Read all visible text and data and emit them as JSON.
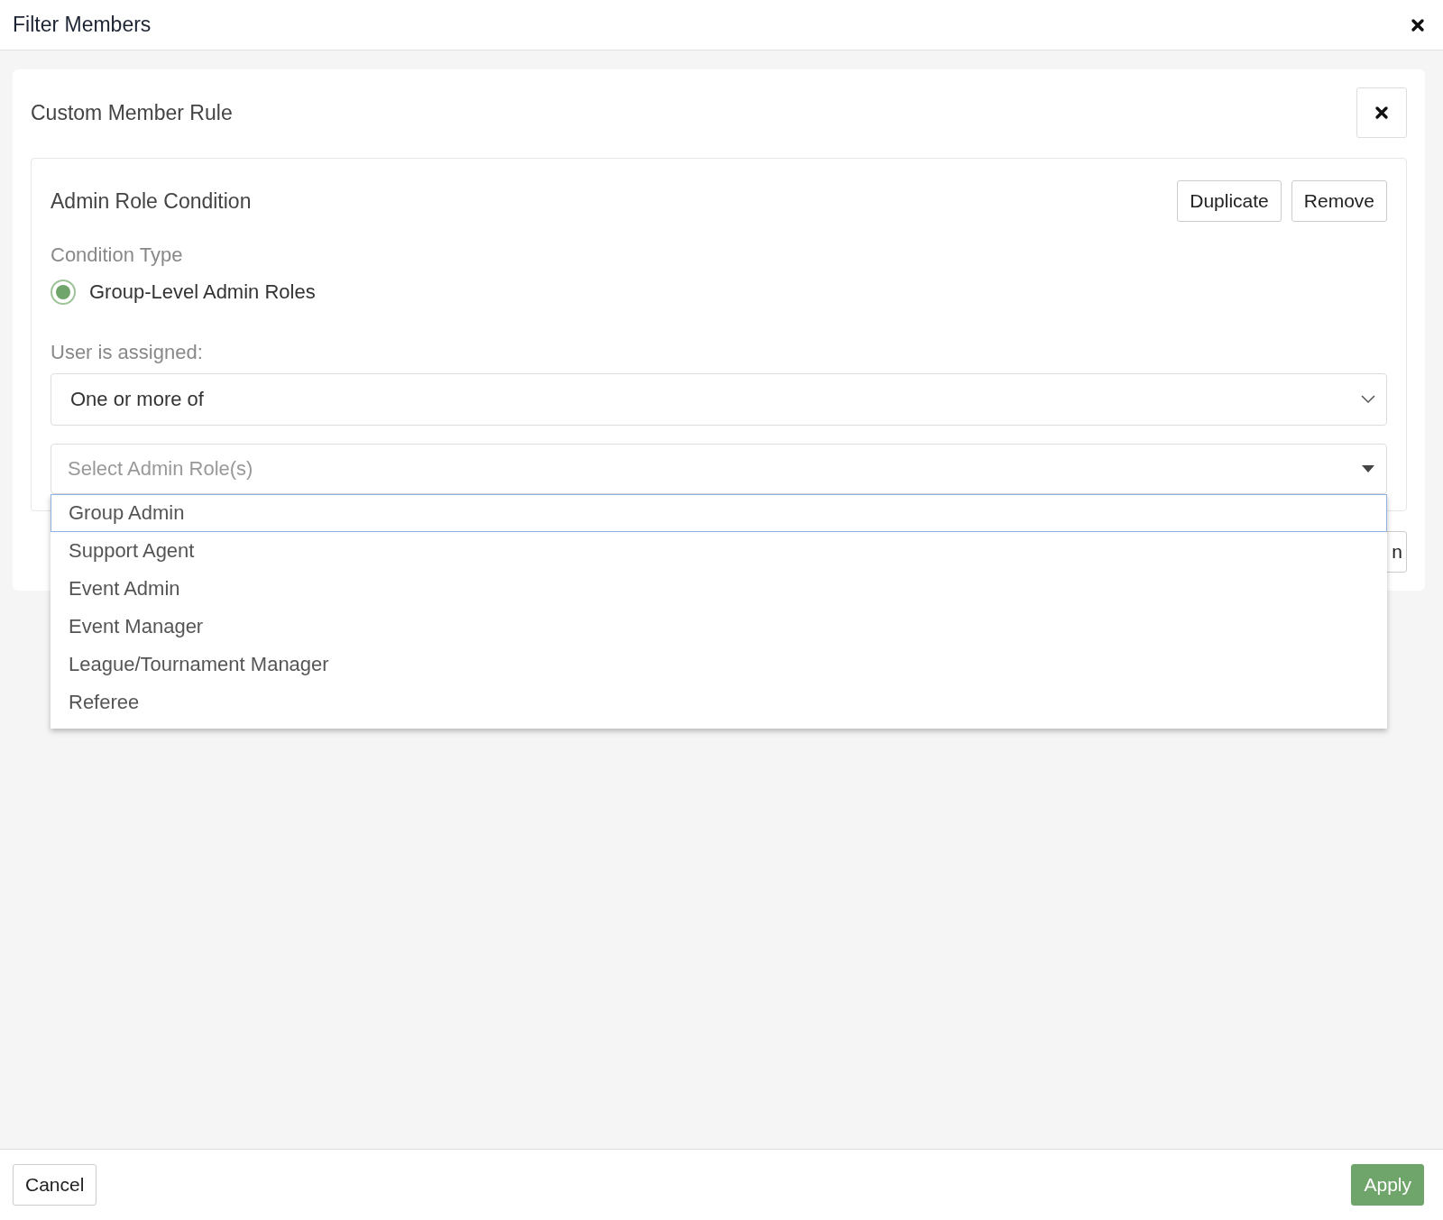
{
  "dialog": {
    "title": "Filter Members"
  },
  "rule": {
    "title": "Custom Member Rule"
  },
  "condition": {
    "title": "Admin Role Condition",
    "buttons": [
      "Duplicate",
      "Remove"
    ],
    "type_label": "Condition Type",
    "types": [
      {
        "label": "Group-Level Admin Roles",
        "selected": true
      }
    ],
    "assigned_label": "User is assigned:",
    "assigned_value": "One or more of",
    "roles_field": {
      "placeholder": "Select Admin Role(s)",
      "expanded": true
    },
    "options": [
      {
        "label": "Group Admin",
        "selected": true
      },
      {
        "label": "Support Agent",
        "selected": false
      },
      {
        "label": "Event Admin",
        "selected": false
      },
      {
        "label": "Event Manager",
        "selected": false
      },
      {
        "label": "League/Tournament Manager",
        "selected": false
      },
      {
        "label": "Referee",
        "selected": false
      }
    ]
  },
  "partial_button": "n",
  "footer": {
    "cancel": "Cancel",
    "apply": "Apply"
  }
}
